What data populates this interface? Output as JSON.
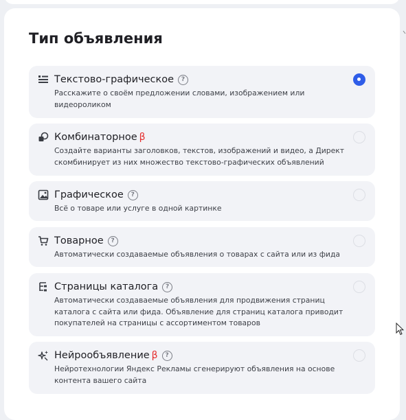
{
  "title": "Тип объявления",
  "options": [
    {
      "icon": "text-graphic-icon",
      "label": "Текстово-графическое",
      "beta": "",
      "help": true,
      "description": "Расскажите о своём предложении словами, изображением или видеороликом",
      "selected": true
    },
    {
      "icon": "combinatorial-icon",
      "label": "Комбинаторное",
      "beta": "β",
      "help": false,
      "description": "Создайте варианты заголовков, текстов, изображений и видео, а Директ скомбинирует из них множество текстово-графических объявлений",
      "selected": false
    },
    {
      "icon": "image-icon",
      "label": "Графическое",
      "beta": "",
      "help": true,
      "description": "Всё о товаре или услуге в одной картинке",
      "selected": false
    },
    {
      "icon": "cart-icon",
      "label": "Товарное",
      "beta": "",
      "help": true,
      "description": "Автоматически создаваемые объявления о товарах с сайта или из фида",
      "selected": false
    },
    {
      "icon": "catalog-tree-icon",
      "label": "Страницы каталога",
      "beta": "",
      "help": true,
      "description": "Автоматически создаваемые объявления для продвижения страниц каталога с сайта или фида. Объявление для страниц каталога приводит покупателей на страницы с ассортиментом товаров",
      "selected": false
    },
    {
      "icon": "sparkles-icon",
      "label": "Нейрообъявление",
      "beta": "β",
      "help": true,
      "description": "Нейротехнологии Яндекс Рекламы сгенерируют объявления на основе контента вашего сайта",
      "selected": false
    }
  ],
  "help_glyph": "?",
  "colors": {
    "accent": "#2f5de8",
    "beta": "#e52b2b",
    "option_bg": "#f2f3f7"
  }
}
